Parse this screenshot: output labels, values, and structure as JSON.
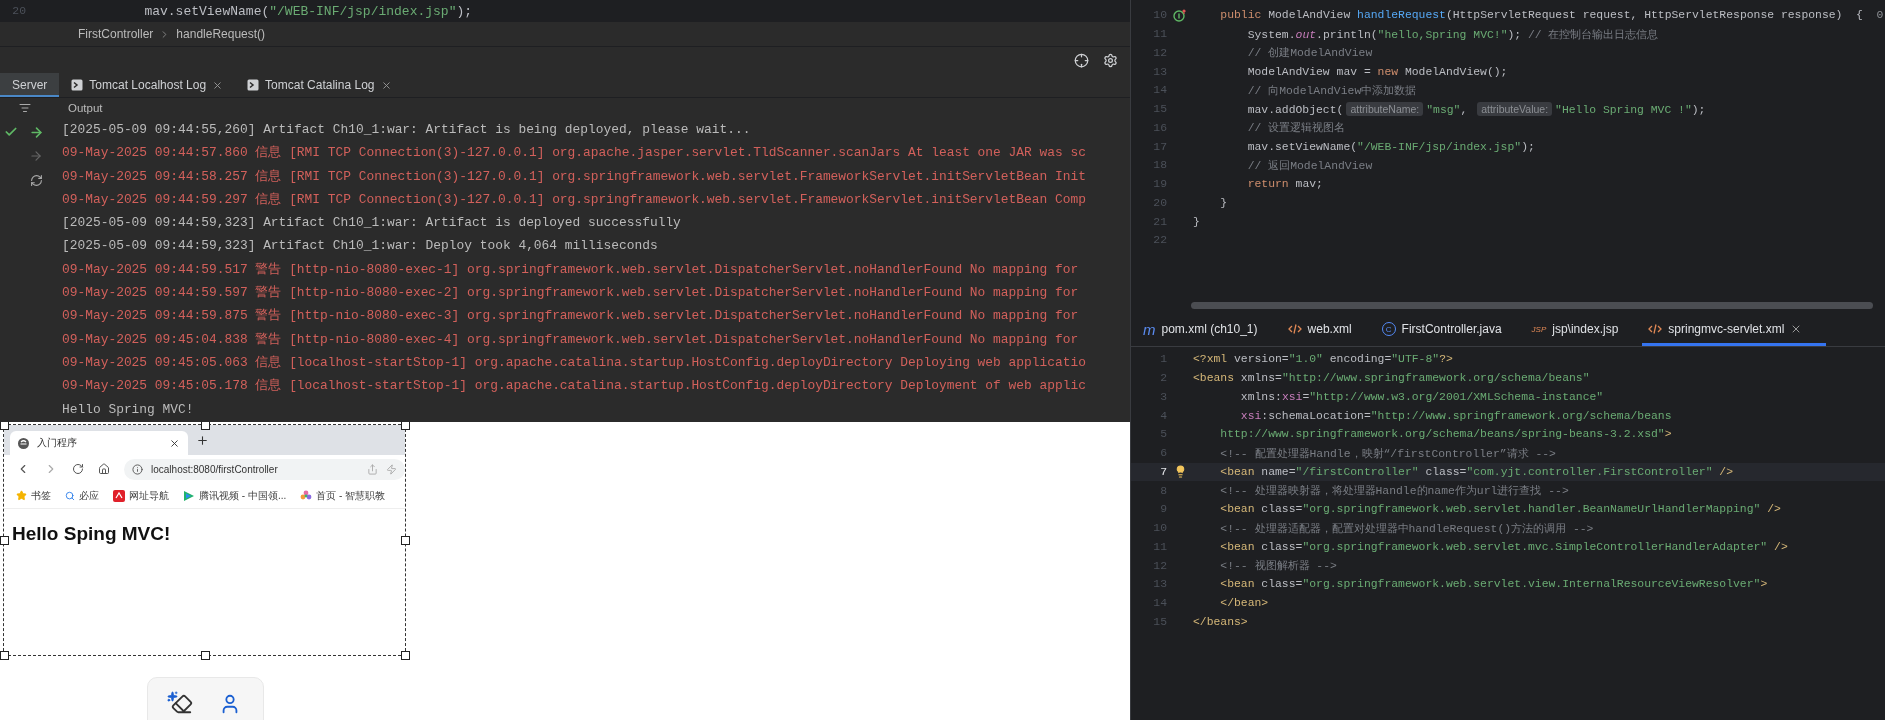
{
  "top_editor": {
    "line_number": "20",
    "tokens": [
      {
        "kind": "plain",
        "text": "        mav.setViewName("
      },
      {
        "kind": "string",
        "text": "\"/WEB-INF/jsp/index.jsp\""
      },
      {
        "kind": "plain",
        "text": ");"
      }
    ]
  },
  "breadcrumb": [
    "FirstController",
    "handleRequest()"
  ],
  "services": {
    "tabs": [
      {
        "label": "Server",
        "kind": "plain",
        "selected": true
      },
      {
        "label": "Tomcat Localhost Log",
        "kind": "log",
        "selected": false
      },
      {
        "label": "Tomcat Catalina Log",
        "kind": "log",
        "selected": false
      }
    ],
    "output_label": "Output",
    "log": [
      {
        "kind": "stdout",
        "text": "[2025-05-09 09:44:55,260] Artifact Ch10_1:war: Artifact is being deployed, please wait..."
      },
      {
        "kind": "stderr",
        "text": "09-May-2025 09:44:57.860 信息 [RMI TCP Connection(3)-127.0.0.1] org.apache.jasper.servlet.TldScanner.scanJars At least one JAR was sc"
      },
      {
        "kind": "stderr",
        "text": "09-May-2025 09:44:58.257 信息 [RMI TCP Connection(3)-127.0.0.1] org.springframework.web.servlet.FrameworkServlet.initServletBean Init"
      },
      {
        "kind": "stderr",
        "text": "09-May-2025 09:44:59.297 信息 [RMI TCP Connection(3)-127.0.0.1] org.springframework.web.servlet.FrameworkServlet.initServletBean Comp"
      },
      {
        "kind": "stdout",
        "text": "[2025-05-09 09:44:59,323] Artifact Ch10_1:war: Artifact is deployed successfully"
      },
      {
        "kind": "stdout",
        "text": "[2025-05-09 09:44:59,323] Artifact Ch10_1:war: Deploy took 4,064 milliseconds"
      },
      {
        "kind": "stderr",
        "text": "09-May-2025 09:44:59.517 警告 [http-nio-8080-exec-1] org.springframework.web.servlet.DispatcherServlet.noHandlerFound No mapping for"
      },
      {
        "kind": "stderr",
        "text": "09-May-2025 09:44:59.597 警告 [http-nio-8080-exec-2] org.springframework.web.servlet.DispatcherServlet.noHandlerFound No mapping for"
      },
      {
        "kind": "stderr",
        "text": "09-May-2025 09:44:59.875 警告 [http-nio-8080-exec-3] org.springframework.web.servlet.DispatcherServlet.noHandlerFound No mapping for"
      },
      {
        "kind": "stderr",
        "text": "09-May-2025 09:45:04.838 警告 [http-nio-8080-exec-4] org.springframework.web.servlet.DispatcherServlet.noHandlerFound No mapping for"
      },
      {
        "kind": "stderr",
        "text": "09-May-2025 09:45:05.063 信息 [localhost-startStop-1] org.apache.catalina.startup.HostConfig.deployDirectory Deploying web applicatio"
      },
      {
        "kind": "stderr",
        "text": "09-May-2025 09:45:05.178 信息 [localhost-startStop-1] org.apache.catalina.startup.HostConfig.deployDirectory Deployment of web applic"
      },
      {
        "kind": "stdout",
        "text": "Hello Spring MVC!"
      }
    ]
  },
  "browser": {
    "tab_title": "入门程序",
    "url": "localhost:8080/firstController",
    "bookmarks": [
      {
        "label": "书签",
        "kind": "star"
      },
      {
        "label": "必应",
        "kind": "search"
      },
      {
        "label": "网址导航",
        "kind": "nav"
      },
      {
        "label": "腾讯视频 - 中国领...",
        "kind": "video"
      },
      {
        "label": "首页 - 智慧职教",
        "kind": "flower"
      }
    ],
    "heading": "Hello Sping MVC!"
  },
  "java_editor": {
    "lines": [
      {
        "number": "10",
        "kind": "override",
        "tokens": [
          {
            "kind": "keyword",
            "text": "    public "
          },
          {
            "kind": "plain",
            "text": "ModelAndView "
          },
          {
            "kind": "method",
            "text": "handleRequest"
          },
          {
            "kind": "plain",
            "text": "(HttpServletRequest request, HttpServletResponse response)  {  "
          },
          {
            "kind": "usage",
            "text": "0"
          }
        ]
      },
      {
        "number": "11",
        "tokens": [
          {
            "kind": "plain",
            "text": "        System."
          },
          {
            "kind": "field",
            "text": "out"
          },
          {
            "kind": "plain",
            "text": ".println("
          },
          {
            "kind": "string",
            "text": "\"hello,Spring MVC!\""
          },
          {
            "kind": "plain",
            "text": "); "
          },
          {
            "kind": "comment",
            "text": "// 在控制台输出日志信息"
          }
        ]
      },
      {
        "number": "12",
        "tokens": [
          {
            "kind": "comment",
            "text": "        // 创建ModelAndView"
          }
        ]
      },
      {
        "number": "13",
        "tokens": [
          {
            "kind": "plain",
            "text": "        ModelAndView mav = "
          },
          {
            "kind": "keyword",
            "text": "new "
          },
          {
            "kind": "plain",
            "text": "ModelAndView();"
          }
        ]
      },
      {
        "number": "14",
        "tokens": [
          {
            "kind": "comment",
            "text": "        // 向ModelAndView中添加数据"
          }
        ]
      },
      {
        "number": "15",
        "tokens": [
          {
            "kind": "plain",
            "text": "        mav.addObject("
          },
          {
            "kind": "hint",
            "text": "attributeName:"
          },
          {
            "kind": "string",
            "text": "\"msg\""
          },
          {
            "kind": "plain",
            "text": ", "
          },
          {
            "kind": "hint",
            "text": "attributeValue:"
          },
          {
            "kind": "string",
            "text": "\"Hello Spring MVC !\""
          },
          {
            "kind": "plain",
            "text": ");"
          }
        ]
      },
      {
        "number": "16",
        "tokens": [
          {
            "kind": "comment",
            "text": "        // 设置逻辑视图名"
          }
        ]
      },
      {
        "number": "17",
        "tokens": [
          {
            "kind": "plain",
            "text": "        mav.setViewName("
          },
          {
            "kind": "string",
            "text": "\"/WEB-INF/jsp/index.jsp\""
          },
          {
            "kind": "plain",
            "text": ");"
          }
        ]
      },
      {
        "number": "18",
        "tokens": [
          {
            "kind": "comment",
            "text": "        // 返回ModelAndView"
          }
        ]
      },
      {
        "number": "19",
        "tokens": [
          {
            "kind": "keyword",
            "text": "        return "
          },
          {
            "kind": "plain",
            "text": "mav;"
          }
        ]
      },
      {
        "number": "20",
        "tokens": [
          {
            "kind": "plain",
            "text": "    }"
          }
        ]
      },
      {
        "number": "21",
        "tokens": [
          {
            "kind": "plain",
            "text": "}"
          }
        ]
      },
      {
        "number": "22"
      }
    ]
  },
  "file_tabs": [
    {
      "label": "pom.xml (ch10_1)",
      "kind": "maven",
      "glyph": "m",
      "selected": false
    },
    {
      "label": "web.xml",
      "kind": "xml",
      "selected": false
    },
    {
      "label": "FirstController.java",
      "kind": "class",
      "glyph": "C",
      "selected": false
    },
    {
      "label": "jsp\\index.jsp",
      "kind": "jsp",
      "glyph": "JSP",
      "selected": false
    },
    {
      "label": "springmvc-servlet.xml",
      "kind": "xml",
      "selected": true
    }
  ],
  "xml_editor": {
    "lines": [
      {
        "number": "1",
        "current": false,
        "tokens": [
          {
            "kind": "tag",
            "text": "<?xml"
          },
          {
            "kind": "plain",
            "text": " version="
          },
          {
            "kind": "string",
            "text": "\"1.0\""
          },
          {
            "kind": "plain",
            "text": " encoding="
          },
          {
            "kind": "string",
            "text": "\"UTF-8\""
          },
          {
            "kind": "tag",
            "text": "?>"
          }
        ]
      },
      {
        "number": "2",
        "current": false,
        "tokens": [
          {
            "kind": "tag",
            "text": "<beans"
          },
          {
            "kind": "plain",
            "text": " xmlns="
          },
          {
            "kind": "string",
            "text": "\"http://www.springframework.org/schema/beans\""
          }
        ]
      },
      {
        "number": "3",
        "current": false,
        "tokens": [
          {
            "kind": "plain",
            "text": "       xmlns:"
          },
          {
            "kind": "ns",
            "text": "xsi"
          },
          {
            "kind": "plain",
            "text": "="
          },
          {
            "kind": "string",
            "text": "\"http://www.w3.org/2001/XMLSchema-instance\""
          }
        ]
      },
      {
        "number": "4",
        "current": false,
        "tokens": [
          {
            "kind": "ns",
            "text": "       xsi"
          },
          {
            "kind": "plain",
            "text": ":schemaLocation="
          },
          {
            "kind": "string",
            "text": "\"http://www.springframework.org/schema/beans"
          }
        ]
      },
      {
        "number": "5",
        "current": false,
        "tokens": [
          {
            "kind": "string",
            "text": "    http://www.springframework.org/schema/beans/spring-beans-3.2.xsd\""
          },
          {
            "kind": "tag",
            "text": ">"
          }
        ]
      },
      {
        "number": "6",
        "current": false,
        "tokens": [
          {
            "kind": "comment",
            "text": "    <!-- 配置处理器Handle，映射“/firstController”请求 -->"
          }
        ]
      },
      {
        "number": "7",
        "current": true,
        "kind": "bulb",
        "tokens": [
          {
            "kind": "tag",
            "text": "    <bean"
          },
          {
            "kind": "plain",
            "text": " name="
          },
          {
            "kind": "string",
            "text": "\"/firstController\""
          },
          {
            "kind": "plain",
            "text": " class="
          },
          {
            "kind": "string",
            "text": "\"com.yjt.controller.FirstController\""
          },
          {
            "kind": "tag",
            "text": " />"
          }
        ]
      },
      {
        "number": "8",
        "current": false,
        "tokens": [
          {
            "kind": "comment",
            "text": "    <!-- 处理器映射器，将处理器Handle的name作为url进行查找 -->"
          }
        ]
      },
      {
        "number": "9",
        "current": false,
        "tokens": [
          {
            "kind": "tag",
            "text": "    <bean"
          },
          {
            "kind": "plain",
            "text": " class="
          },
          {
            "kind": "string",
            "text": "\"org.springframework.web.servlet.handler.BeanNameUrlHandlerMapping\""
          },
          {
            "kind": "tag",
            "text": " />"
          }
        ]
      },
      {
        "number": "10",
        "current": false,
        "tokens": [
          {
            "kind": "comment",
            "text": "    <!-- 处理器适配器，配置对处理器中handleRequest()方法的调用 -->"
          }
        ]
      },
      {
        "number": "11",
        "current": false,
        "tokens": [
          {
            "kind": "tag",
            "text": "    <bean"
          },
          {
            "kind": "plain",
            "text": " class="
          },
          {
            "kind": "string",
            "text": "\"org.springframework.web.servlet.mvc.SimpleControllerHandlerAdapter\""
          },
          {
            "kind": "tag",
            "text": " />"
          }
        ]
      },
      {
        "number": "12",
        "current": false,
        "tokens": [
          {
            "kind": "comment",
            "text": "    <!-- 视图解析器 -->"
          }
        ]
      },
      {
        "number": "13",
        "current": false,
        "tokens": [
          {
            "kind": "tag",
            "text": "    <bean"
          },
          {
            "kind": "plain",
            "text": " class="
          },
          {
            "kind": "string",
            "text": "\"org.springframework.web.servlet.view.InternalResourceViewResolver\""
          },
          {
            "kind": "tag",
            "text": ">"
          }
        ]
      },
      {
        "number": "14",
        "current": false,
        "tokens": [
          {
            "kind": "tag",
            "text": "    </bean>"
          }
        ]
      },
      {
        "number": "15",
        "current": false,
        "tokens": [
          {
            "kind": "tag",
            "text": "</beans>"
          }
        ]
      }
    ]
  }
}
